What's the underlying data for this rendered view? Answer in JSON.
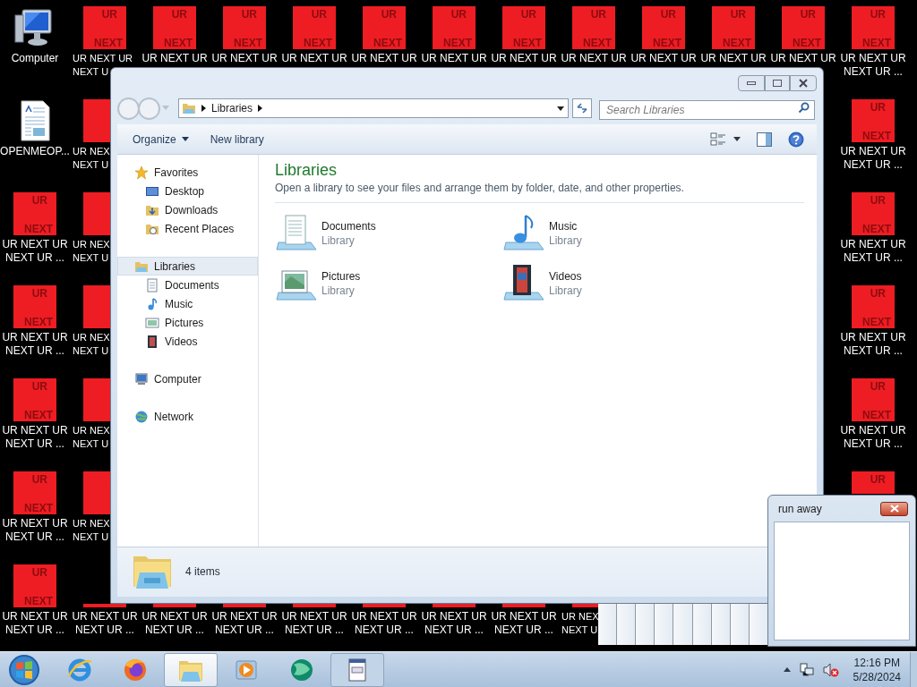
{
  "desktop": {
    "columns": [
      [
        {
          "kind": "computer",
          "label_lines": [
            "Computer"
          ]
        },
        {
          "kind": "document",
          "label_lines": [
            "OPENMEOP..."
          ]
        },
        {
          "kind": "tile",
          "tile_text": [
            "UR",
            "NEXT"
          ],
          "label_lines": [
            "UR NEXT UR",
            "NEXT UR ..."
          ]
        },
        {
          "kind": "tile",
          "tile_text": [
            "UR",
            "NEXT"
          ],
          "label_lines": [
            "UR NEXT UR",
            "NEXT UR ..."
          ]
        },
        {
          "kind": "tile",
          "tile_text": [
            "UR",
            "NEXT"
          ],
          "label_lines": [
            "UR NEXT UR",
            "NEXT UR ..."
          ]
        },
        {
          "kind": "tile",
          "tile_text": [
            "UR",
            "NEXT"
          ],
          "label_lines": [
            "UR NEXT UR",
            "NEXT UR ..."
          ]
        },
        {
          "kind": "tile",
          "tile_text": [
            "UR",
            "NEXT"
          ],
          "label_lines": [
            "UR NEXT UR",
            "NEXT UR ..."
          ]
        }
      ],
      [
        {
          "kind": "tile",
          "tile_text": [
            "UR",
            "NEXT"
          ],
          "label_lines": [
            "UR NEXT UR",
            "NEXT U"
          ],
          "cut": true
        },
        {
          "kind": "tile_left",
          "label_lines": [
            "UR NEX",
            "NEXT U"
          ],
          "cut": true
        },
        {
          "kind": "tile_left",
          "label_lines": [
            "UR NEX",
            "NEXT U"
          ],
          "cut": true
        },
        {
          "kind": "tile_left",
          "label_lines": [
            "UR NEX",
            "NEXT U"
          ],
          "cut": true
        },
        {
          "kind": "tile_left",
          "label_lines": [
            "UR NEX",
            "NEXT U"
          ],
          "cut": true
        },
        {
          "kind": "tile_left",
          "label_lines": [
            "UR NEX",
            "NEXT U"
          ],
          "cut": true
        },
        {
          "kind": "tile_bottom",
          "label_lines": [
            "UR NEXT UR",
            "NEXT UR ..."
          ]
        }
      ],
      [
        {
          "kind": "tile",
          "tile_text": [
            "UR",
            "NEXT"
          ],
          "label_lines": [
            "UR NEXT UR"
          ]
        },
        {
          "kind": "tile_bottom",
          "label_lines": [
            "UR NEXT UR",
            "NEXT UR ..."
          ]
        }
      ],
      [
        {
          "kind": "tile",
          "tile_text": [
            "UR",
            "NEXT"
          ],
          "label_lines": [
            "UR NEXT UR"
          ]
        },
        {
          "kind": "tile_bottom",
          "label_lines": [
            "UR NEXT UR",
            "NEXT UR ..."
          ]
        }
      ],
      [
        {
          "kind": "tile",
          "tile_text": [
            "UR",
            "NEXT"
          ],
          "label_lines": [
            "UR NEXT UR"
          ]
        },
        {
          "kind": "tile_bottom",
          "label_lines": [
            "UR NEXT UR",
            "NEXT UR ..."
          ]
        }
      ],
      [
        {
          "kind": "tile",
          "tile_text": [
            "UR",
            "NEXT"
          ],
          "label_lines": [
            "UR NEXT UR"
          ]
        },
        {
          "kind": "tile_bottom",
          "label_lines": [
            "UR NEXT UR",
            "NEXT UR ..."
          ]
        }
      ],
      [
        {
          "kind": "tile",
          "tile_text": [
            "UR",
            "NEXT"
          ],
          "label_lines": [
            "UR NEXT UR"
          ]
        },
        {
          "kind": "tile_bottom",
          "label_lines": [
            "UR NEXT UR",
            "NEXT UR ..."
          ]
        }
      ],
      [
        {
          "kind": "tile",
          "tile_text": [
            "UR",
            "NEXT"
          ],
          "label_lines": [
            "UR NEXT UR"
          ]
        },
        {
          "kind": "tile_bottom",
          "label_lines": [
            "UR NEXT UR",
            "NEXT UR ..."
          ]
        }
      ],
      [
        {
          "kind": "tile",
          "tile_text": [
            "UR",
            "NEXT"
          ],
          "label_lines": [
            "UR NEXT UR"
          ]
        },
        {
          "kind": "tile_corner",
          "label_lines": [
            "UR NEX",
            "NEXT U"
          ],
          "cut": true
        }
      ],
      [
        {
          "kind": "tile",
          "tile_text": [
            "UR",
            "NEXT"
          ],
          "label_lines": [
            "UR NEXT UR"
          ]
        }
      ],
      [
        {
          "kind": "tile",
          "tile_text": [
            "UR",
            "NEXT"
          ],
          "label_lines": [
            "UR NEXT UR"
          ]
        }
      ],
      [
        {
          "kind": "tile",
          "tile_text": [
            "UR",
            "NEXT"
          ],
          "label_lines": [
            "UR NEXT UR"
          ]
        }
      ],
      [
        {
          "kind": "tile",
          "tile_text": [
            "UR",
            "NEXT"
          ],
          "label_lines": [
            "UR NEXT UR",
            "NEXT UR ..."
          ]
        },
        {
          "kind": "tile",
          "tile_text": [
            "UR",
            "NEXT"
          ],
          "label_lines": [
            "UR NEXT UR",
            "NEXT UR ..."
          ]
        },
        {
          "kind": "tile",
          "tile_text": [
            "UR",
            "NEXT"
          ],
          "label_lines": [
            "UR NEXT UR",
            "NEXT UR ..."
          ]
        },
        {
          "kind": "tile",
          "tile_text": [
            "UR",
            "NEXT"
          ],
          "label_lines": [
            "UR NEXT UR",
            "NEXT UR ..."
          ]
        },
        {
          "kind": "tile",
          "tile_text": [
            "UR",
            "NEXT"
          ],
          "label_lines": [
            "UR NEXT UR",
            "NEXT UR ..."
          ]
        },
        {
          "kind": "tile_top",
          "tile_text": [
            "UR"
          ]
        }
      ]
    ]
  },
  "explorer": {
    "address": {
      "crumbs": [
        "Libraries"
      ]
    },
    "search": {
      "placeholder": "Search Libraries"
    },
    "toolbar": [
      {
        "label": "Organize",
        "kind": "menu"
      },
      {
        "label": "New library",
        "kind": "plain"
      }
    ],
    "nav": [
      {
        "label": "Favorites",
        "kind": "star",
        "selected": false,
        "children": [
          {
            "label": "Desktop",
            "kind": "desktop",
            "selected": false
          },
          {
            "label": "Downloads",
            "kind": "downloads",
            "selected": false
          },
          {
            "label": "Recent Places",
            "kind": "recent",
            "selected": false
          }
        ]
      },
      {
        "label": "Libraries",
        "kind": "library",
        "selected": true,
        "children": [
          {
            "label": "Documents",
            "kind": "documents",
            "selected": false
          },
          {
            "label": "Music",
            "kind": "music",
            "selected": false
          },
          {
            "label": "Pictures",
            "kind": "pictures",
            "selected": false
          },
          {
            "label": "Videos",
            "kind": "videos",
            "selected": false
          }
        ]
      },
      {
        "label": "Computer",
        "kind": "computer",
        "selected": false
      },
      {
        "label": "Network",
        "kind": "network",
        "selected": false
      }
    ],
    "heading": "Libraries",
    "subtitle": "Open a library to see your files and arrange them by folder, date, and other properties.",
    "libraries": [
      {
        "name": "Documents",
        "type": "Library",
        "kind": "documents"
      },
      {
        "name": "Music",
        "type": "Library",
        "kind": "music"
      },
      {
        "name": "Pictures",
        "type": "Library",
        "kind": "pictures"
      },
      {
        "name": "Videos",
        "type": "Library",
        "kind": "videos"
      }
    ],
    "status": "4 items"
  },
  "dialog": {
    "title": "run away"
  },
  "taskbar": {
    "apps": [
      {
        "kind": "ie",
        "running": false,
        "selected": false
      },
      {
        "kind": "firefox",
        "running": false,
        "selected": false
      },
      {
        "kind": "explorer",
        "running": true,
        "selected": true
      },
      {
        "kind": "media",
        "running": false,
        "selected": false
      },
      {
        "kind": "globe",
        "running": false,
        "selected": false
      },
      {
        "kind": "notepad",
        "running": true,
        "selected": false
      }
    ],
    "time": "12:16 PM",
    "date": "5/28/2024"
  }
}
